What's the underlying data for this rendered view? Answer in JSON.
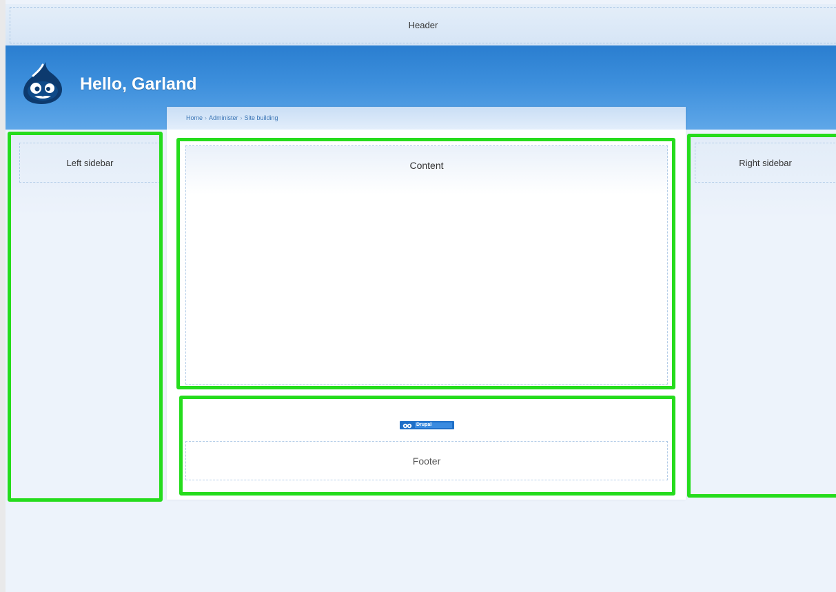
{
  "regions": {
    "header": "Header",
    "left_sidebar": "Left sidebar",
    "content": "Content",
    "right_sidebar": "Right sidebar",
    "footer": "Footer"
  },
  "branding": {
    "site_title": "Hello, Garland",
    "logo_icon": "drupal-drop-logo-icon"
  },
  "breadcrumb": {
    "items": [
      "Home",
      "Administer",
      "Site building"
    ],
    "separator": "›"
  },
  "footer": {
    "powered_badge": "Drupal",
    "badge_icon": "drupal-drop-icon"
  },
  "colors": {
    "branding_blue": "#2a7ed0",
    "highlight_green": "#25dc1c",
    "page_background": "#edf3fb"
  }
}
